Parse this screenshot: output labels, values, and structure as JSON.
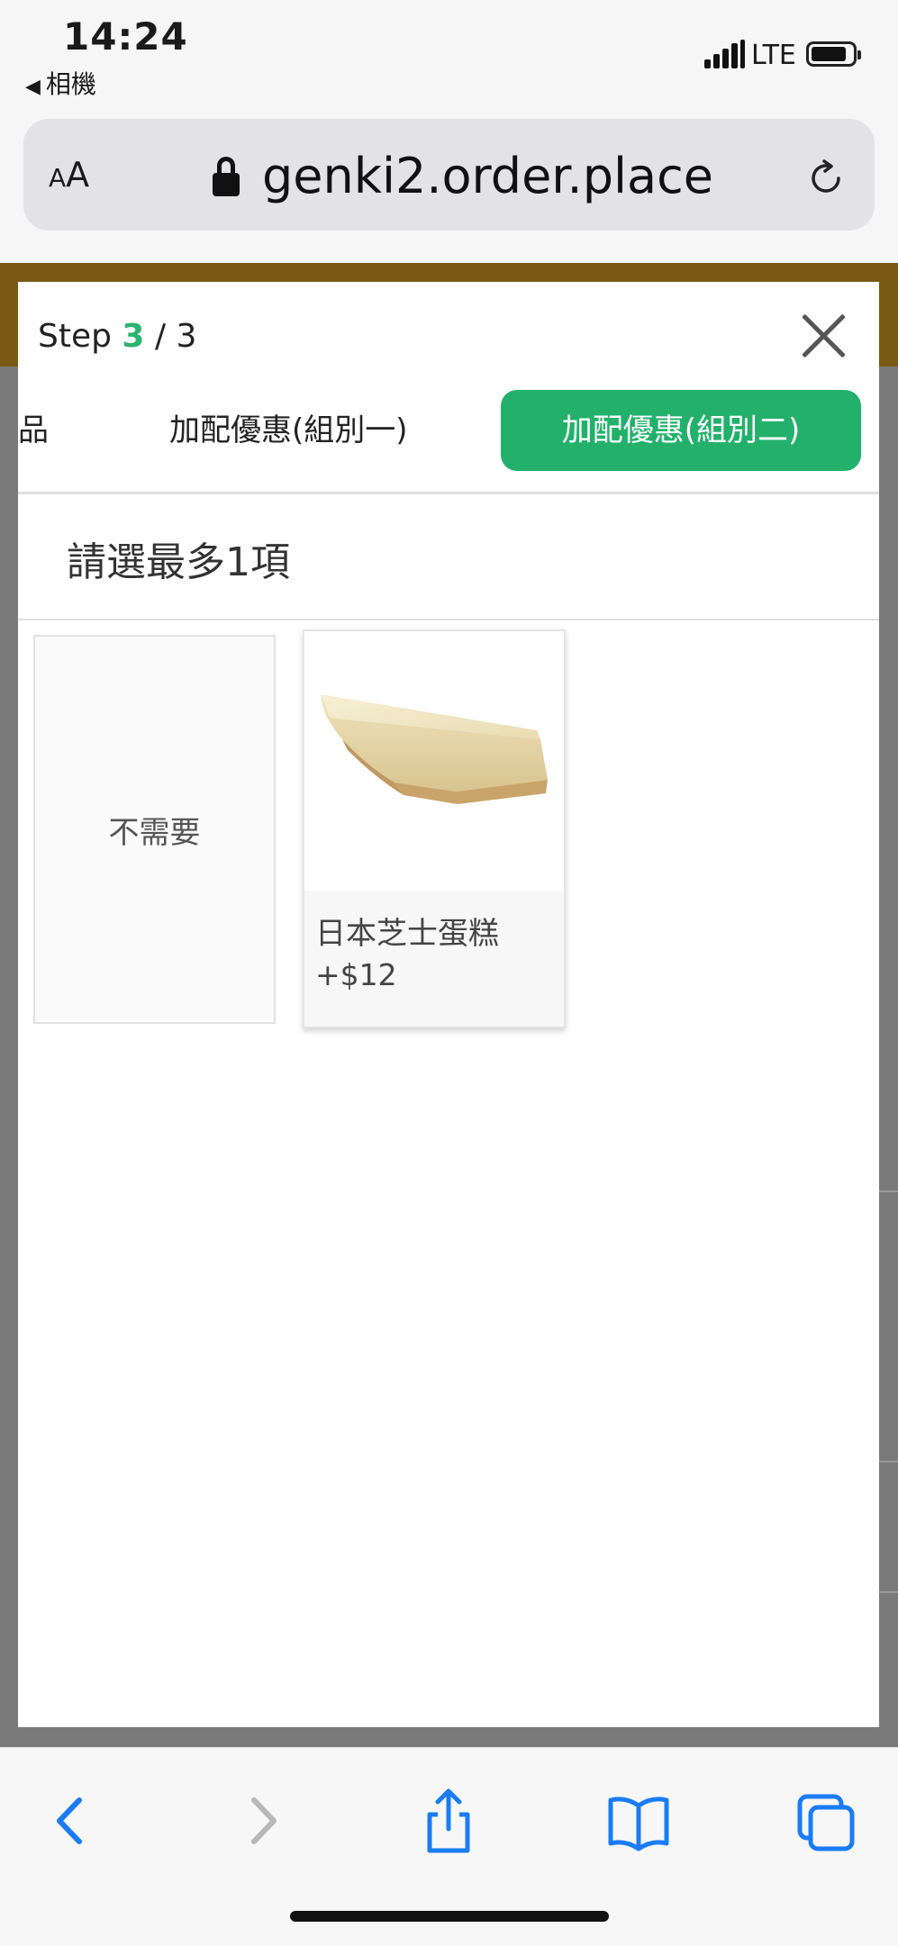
{
  "status_bar": {
    "time": "14:24",
    "back_app": "相機",
    "network": "LTE",
    "battery_level": 0.75
  },
  "browser": {
    "text_size_button": {
      "small": "A",
      "large": "A"
    },
    "url": "genki2.order.place",
    "lock_icon": "lock-icon",
    "reload_icon": "reload-icon"
  },
  "modal": {
    "step_prefix": "Step",
    "step_current": "3",
    "step_separator": "/",
    "step_total": "3",
    "tabs": [
      {
        "label": "品",
        "active": false
      },
      {
        "label": "加配優惠(組別一)",
        "active": false
      },
      {
        "label": "加配優惠(組別二)",
        "active": true
      }
    ],
    "instruction": "請選最多1項",
    "options": [
      {
        "label": "不需要"
      },
      {
        "name": "日本芝士蛋糕",
        "price": "+$12"
      }
    ]
  },
  "colors": {
    "accent_green": "#23b06b",
    "header_gold": "#7a5a12"
  },
  "toolbar": {
    "icons": [
      "back-icon",
      "forward-icon",
      "share-icon",
      "bookmarks-icon",
      "tabs-icon"
    ]
  }
}
